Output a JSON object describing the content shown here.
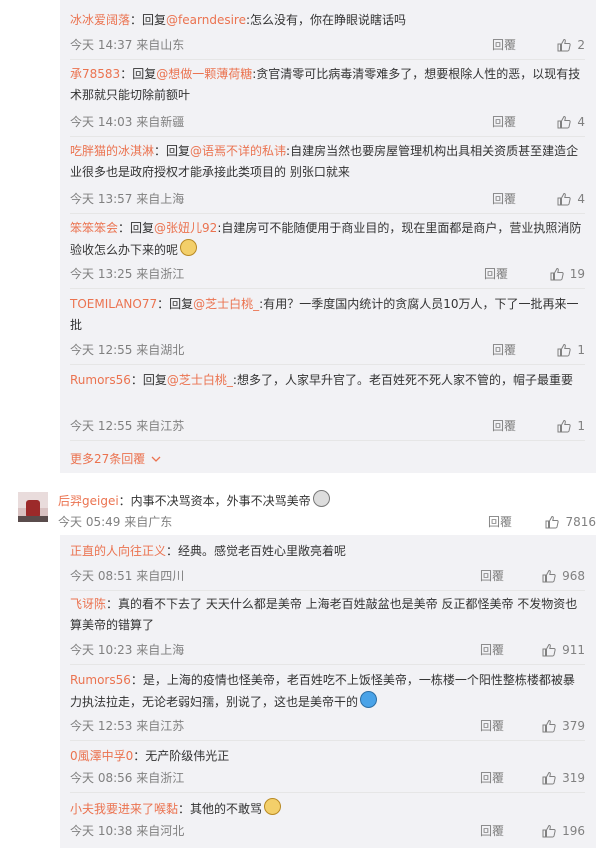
{
  "sub_top": [
    {
      "name": "冰冰爱阔落",
      "text_before": "：回复",
      "at": "@fearndesire",
      "text_after": ":怎么没有，你在睁眼说瞎话吗",
      "time": "今天 14:37 来自山东",
      "reply": "回覆",
      "likes": "2"
    },
    {
      "name": "承78583",
      "text_before": "：回复",
      "at": "@想做一颗薄荷糖",
      "text_after": ":贪官清零可比病毒清零难多了，想要根除人性的恶，以现有技术那就只能切除前额叶",
      "time": "今天 14:03 来自新疆",
      "reply": "回覆",
      "likes": "4"
    },
    {
      "name": "吃胖猫的冰淇淋",
      "text_before": "：回复",
      "at": "@语焉不详的私讳",
      "text_after": ":自建房当然也要房屋管理机构出具相关资质甚至建造企业很多也是政府授权才能承接此类项目的 别张口就来",
      "time": "今天 13:57 来自上海",
      "reply": "回覆",
      "likes": "4"
    },
    {
      "name": "笨笨笨会",
      "text_before": "：回复",
      "at": "@张妞儿92",
      "text_after": ":自建房可不能随便用于商业目的，现在里面都是商户，营业执照消防验收怎么办下来的呢",
      "time": "今天 13:25 来自浙江",
      "reply": "回覆",
      "likes": "19",
      "emoji": "cat"
    },
    {
      "name": "TOEMILANO77",
      "text_before": "：回复",
      "at": "@芝士白桃_",
      "text_after": ":有用？一季度国内统计的贪腐人员10万人，下了一批再来一批",
      "time": "今天 12:55 来自湖北",
      "reply": "回覆",
      "likes": "1"
    },
    {
      "name": "Rumors56",
      "text_before": "：回复",
      "at": "@芝士白桃_",
      "text_after": ":想多了，人家早升官了。老百姓死不死人家不管的，帽子最重要",
      "time": "今天 12:55 来自江苏",
      "reply": "回覆",
      "likes": "1"
    }
  ],
  "more_replies": "更多27条回覆",
  "main_comment": {
    "name": "后羿geigei",
    "text": "：内事不决骂资本，外事不决骂美帝",
    "emoji": "mask",
    "time": "今天 05:49 来自广东",
    "reply": "回覆",
    "likes": "7816"
  },
  "sub_bottom": [
    {
      "name": "正直的人向往正义",
      "text": "：经典。感觉老百姓心里敞亮着呢",
      "time": "今天 08:51 来自四川",
      "reply": "回覆",
      "likes": "968"
    },
    {
      "name": "飞讶陈",
      "text": "：真的看不下去了 天天什么都是美帝 上海老百姓敲盆也是美帝 反正都怪美帝 不发物资也算美帝的错算了",
      "time": "今天 10:23 来自上海",
      "reply": "回覆",
      "likes": "911"
    },
    {
      "name": "Rumors56",
      "text": "：是，上海的疫情也怪美帝，老百姓吃不上饭怪美帝，一栋楼一个阳性整栋楼都被暴力执法拉走，无论老弱妇孺，别说了，这也是美帝干的",
      "emoji": "ppl",
      "time": "今天 12:53 来自江苏",
      "reply": "回覆",
      "likes": "379"
    },
    {
      "name": "0風澤中孚0",
      "text": "：无产阶级伟光正",
      "time": "今天 08:56 来自浙江",
      "reply": "回覆",
      "likes": "319"
    },
    {
      "name": "小夫我要进来了喉黏",
      "text": "：其他的不敢骂",
      "emoji": "cat",
      "time": "今天 10:38 来自河北",
      "reply": "回覆",
      "likes": "196"
    }
  ]
}
